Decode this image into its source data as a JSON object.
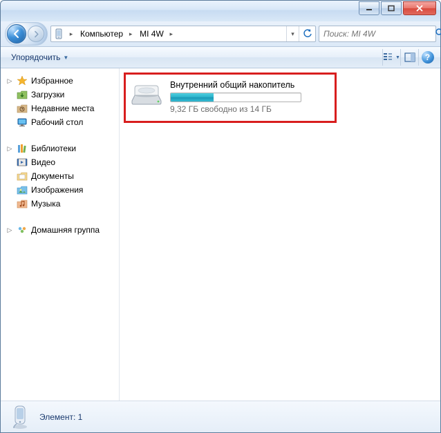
{
  "breadcrumb": {
    "seg1": "Компьютер",
    "seg2": "MI 4W"
  },
  "search": {
    "placeholder": "Поиск: MI 4W"
  },
  "toolbar": {
    "organize": "Упорядочить"
  },
  "sidebar": {
    "favorites": {
      "label": "Избранное",
      "items": [
        "Загрузки",
        "Недавние места",
        "Рабочий стол"
      ]
    },
    "libraries": {
      "label": "Библиотеки",
      "items": [
        "Видео",
        "Документы",
        "Изображения",
        "Музыка"
      ]
    },
    "homegroup": {
      "label": "Домашняя группа"
    }
  },
  "drive": {
    "name": "Внутренний общий накопитель",
    "status": "9,32 ГБ свободно из 14 ГБ",
    "fill_percent": 33
  },
  "statusbar": {
    "text": "Элемент: 1"
  }
}
